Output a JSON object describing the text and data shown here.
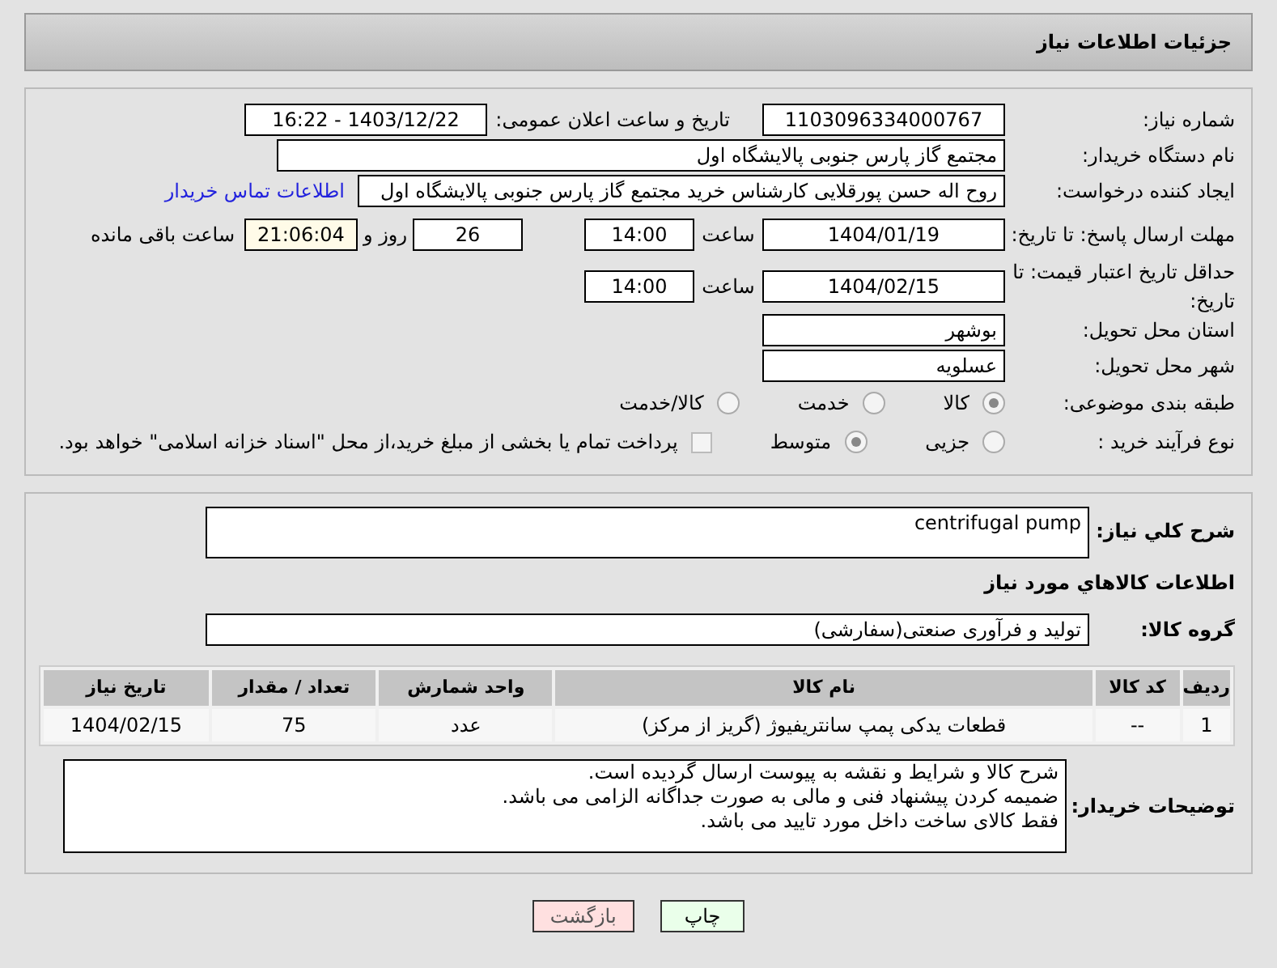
{
  "header": {
    "title": "جزئیات اطلاعات نیاز"
  },
  "need_number": {
    "label": "شماره نیاز:",
    "value": "1103096334000767"
  },
  "announce_date": {
    "label": "تاریخ و ساعت اعلان عمومی:",
    "value": "1403/12/22 - 16:22"
  },
  "buyer_org": {
    "label": "نام دستگاه خریدار:",
    "value": "مجتمع گاز پارس جنوبی  پالایشگاه اول"
  },
  "requester": {
    "label": "ایجاد کننده درخواست:",
    "value": "روح اله حسن پورقلایی کارشناس خرید مجتمع گاز پارس جنوبی  پالایشگاه اول",
    "link": "اطلاعات تماس خریدار"
  },
  "reply_deadline": {
    "label": "مهلت ارسال پاسخ: تا تاریخ:",
    "date": "1404/01/19",
    "time_label": "ساعت",
    "time": "14:00",
    "days": "26",
    "days_label": "روز و",
    "remaining": "21:06:04",
    "remaining_label": "ساعت باقی مانده"
  },
  "price_validity": {
    "label": "حداقل تاریخ اعتبار قیمت: تا تاریخ:",
    "date": "1404/02/15",
    "time_label": "ساعت",
    "time": "14:00"
  },
  "province": {
    "label": "استان محل تحویل:",
    "value": "بوشهر"
  },
  "city": {
    "label": "شهر محل تحویل:",
    "value": "عسلویه"
  },
  "category": {
    "label": "طبقه بندی موضوعی:",
    "options": [
      {
        "label": "کالا",
        "selected": true
      },
      {
        "label": "خدمت",
        "selected": false
      },
      {
        "label": "کالا/خدمت",
        "selected": false
      }
    ]
  },
  "process": {
    "label": "نوع فرآیند خرید :",
    "options": [
      {
        "label": "جزیی",
        "selected": false
      },
      {
        "label": "متوسط",
        "selected": true
      }
    ],
    "payment": {
      "label": "پرداخت تمام یا بخشی از مبلغ خرید،از محل \"اسناد خزانه اسلامی\" خواهد بود.",
      "checked": false
    }
  },
  "description": {
    "label": "شرح کلي نیاز:",
    "value": "centrifugal pump"
  },
  "goods_heading": "اطلاعات کالاهاي مورد نیاز",
  "goods_group": {
    "label": "گروه کالا:",
    "value": "تولید و فرآوری صنعتی(سفارشی)"
  },
  "table": {
    "columns": [
      "ردیف",
      "کد کالا",
      "نام کالا",
      "واحد شمارش",
      "تعداد / مقدار",
      "تاریخ نیاز"
    ],
    "rows": [
      [
        "1",
        "--",
        "قطعات یدکی پمپ سانتریفیوژ (گریز از مرکز)",
        "عدد",
        "75",
        "1404/02/15"
      ]
    ]
  },
  "buyer_notes": {
    "label": "توضیحات خریدار:",
    "lines": [
      "شرح کالا و شرایط و نقشه به پیوست ارسال گردیده است.",
      "ضمیمه کردن پیشنهاد فنی و مالی به صورت جداگانه الزامی می باشد.",
      "فقط کالای ساخت داخل مورد تایید می باشد."
    ]
  },
  "buttons": [
    {
      "kind": "print",
      "label": "چاپ"
    },
    {
      "kind": "back",
      "label": "بازگشت"
    }
  ]
}
